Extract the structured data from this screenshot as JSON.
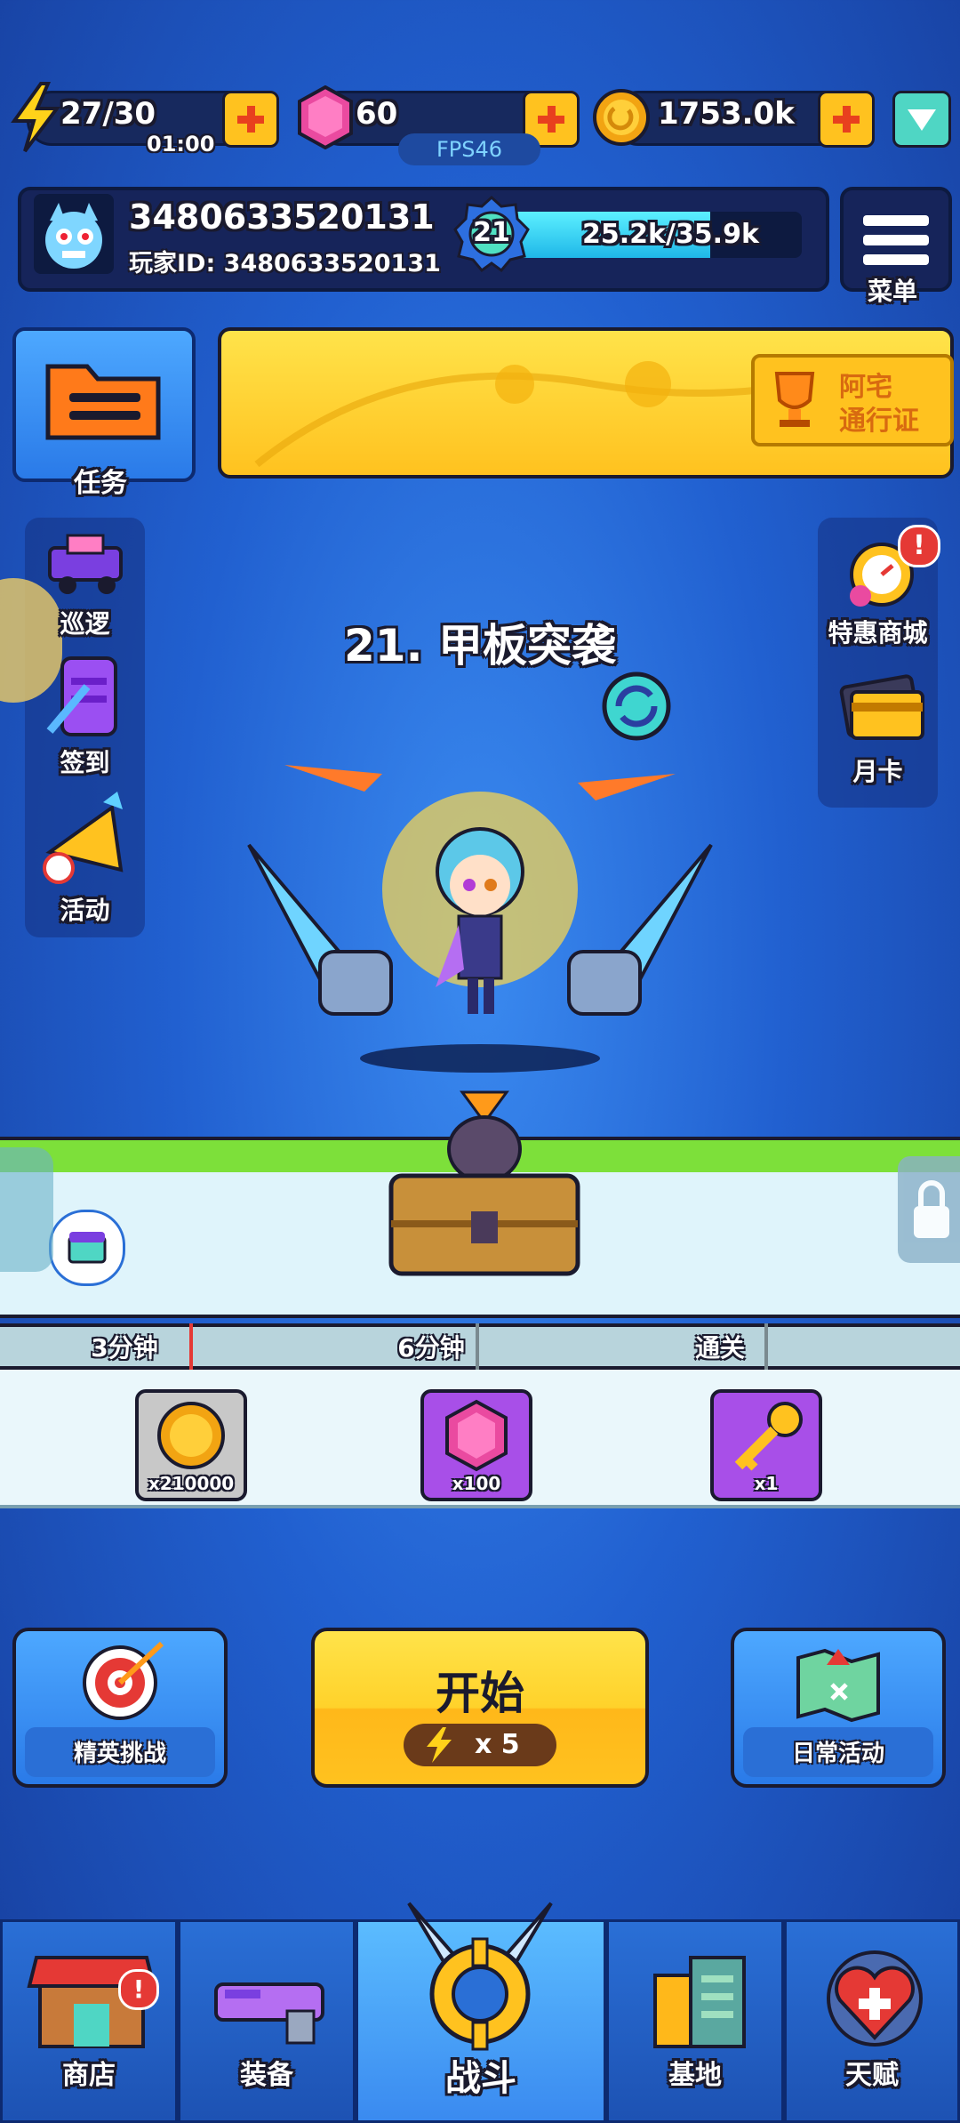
{
  "resources": {
    "energy": "27/30",
    "energy_timer": "01:00",
    "gems": "60",
    "gold": "1753.0k",
    "fps": "FPS46"
  },
  "player": {
    "name": "3480633520131",
    "id_line": "玩家ID: 3480633520131",
    "level": "21",
    "exp": "25.2k/35.9k",
    "exp_progress": 0.7
  },
  "menu_label": "菜单",
  "task_label": "任务",
  "pass_label_1": "阿宅",
  "pass_label_2": "通行证",
  "left_side": [
    "巡逻",
    "签到",
    "活动"
  ],
  "right_side": [
    "特惠商城",
    "月卡"
  ],
  "stage_title": "21. 甲板突袭",
  "milestones": [
    "3分钟",
    "6分钟",
    "通关"
  ],
  "rewards": [
    {
      "icon": "gold-coin-icon",
      "count": "x210000"
    },
    {
      "icon": "gem-icon",
      "count": "x100"
    },
    {
      "icon": "key-icon",
      "count": "x1"
    }
  ],
  "buttons": {
    "elite": "精英挑战",
    "start": "开始",
    "start_cost": "x 5",
    "daily": "日常活动"
  },
  "nav": [
    "商店",
    "装备",
    "战斗",
    "基地",
    "天赋"
  ],
  "colors": {
    "accent_yellow": "#ffc21f",
    "gem_pink": "#e0449a",
    "badge_red": "#e53935"
  }
}
